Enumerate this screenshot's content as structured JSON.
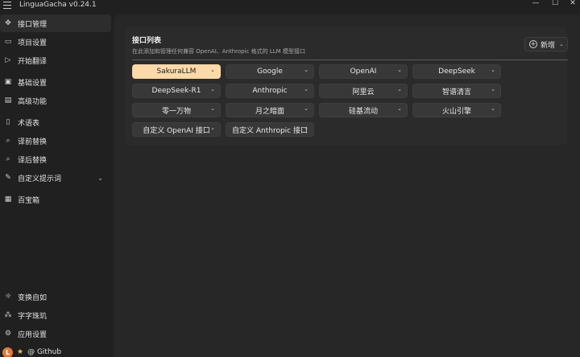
{
  "app": {
    "title": "LinguaGacha v0.24.1",
    "window_buttons": [
      "—",
      "☐",
      "✕"
    ]
  },
  "sidebar": {
    "items": [
      {
        "label": "接口管理",
        "icon": "interface-icon",
        "glyph": "✥",
        "active": true
      },
      {
        "label": "项目设置",
        "icon": "folder-icon",
        "glyph": "▭"
      },
      {
        "label": "开始翻译",
        "icon": "play-icon",
        "glyph": "▷"
      },
      {
        "label": "基础设置",
        "icon": "settings-icon",
        "glyph": "▣"
      },
      {
        "label": "高级功能",
        "icon": "advanced-icon",
        "glyph": "▤"
      },
      {
        "label": "术语表",
        "icon": "book-icon",
        "glyph": "▯"
      },
      {
        "label": "译前替换",
        "icon": "search-icon",
        "glyph": "⌕"
      },
      {
        "label": "译后替换",
        "icon": "search-icon",
        "glyph": "⌕"
      },
      {
        "label": "自定义提示词",
        "icon": "edit-icon",
        "glyph": "✎",
        "has_chevron": true
      },
      {
        "label": "百宝箱",
        "icon": "toolbox-icon",
        "glyph": "▦"
      }
    ],
    "bottom_items": [
      {
        "label": "变换自如",
        "icon": "theme-icon",
        "glyph": "☼"
      },
      {
        "label": "字字珠玑",
        "icon": "text-icon",
        "glyph": "⁂"
      },
      {
        "label": "应用设置",
        "icon": "gear-icon",
        "glyph": "⚙"
      }
    ],
    "github": {
      "avatar_letter": "L",
      "star": "★",
      "label": "@ Github"
    },
    "chevron": "⌄"
  },
  "main": {
    "card_title": "接口列表",
    "card_subtitle": "在此添加和管理任何兼容 OpenAI、Anthropic 格式的 LLM 模型接口",
    "add_button": {
      "label": "新增",
      "icon": "plus-circle-icon",
      "glyph": "+",
      "chevron": "⌄"
    },
    "platforms": [
      {
        "label": "SakuraLLM",
        "selected": true
      },
      {
        "label": "Google"
      },
      {
        "label": "OpenAI"
      },
      {
        "label": "DeepSeek"
      },
      {
        "label": "DeepSeek-R1"
      },
      {
        "label": "Anthropic"
      },
      {
        "label": "阿里云"
      },
      {
        "label": "智谱清言"
      },
      {
        "label": "零一万物"
      },
      {
        "label": "月之暗面"
      },
      {
        "label": "硅基流动"
      },
      {
        "label": "火山引擎"
      },
      {
        "label": "自定义 OpenAI 接口"
      },
      {
        "label": "自定义 Anthropic 接口"
      }
    ],
    "chevron": "⌄"
  },
  "colors": {
    "background": "#202020",
    "panel": "#272727",
    "card": "#2b2b2b",
    "button": "#383838",
    "selected_button": "#fcd9a8",
    "avatar": "#e07a3a"
  }
}
